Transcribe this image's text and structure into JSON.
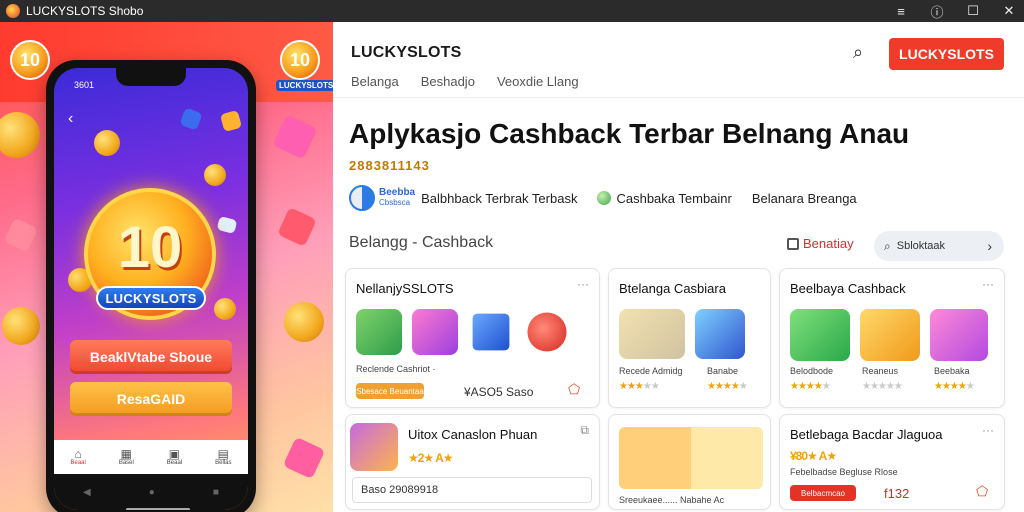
{
  "window": {
    "title": "LUCKYSLOTS Shobo"
  },
  "promo": {
    "corner_badge_left": "10",
    "corner_badge_right": "10",
    "corner_label": "LUCKYSLOTS",
    "phone": {
      "time": "3601",
      "badge_number": "10",
      "logo_text": "LUCKYSLOTS",
      "button_primary": "BeaklVtabe Sboue",
      "button_secondary": "ResaGAID",
      "nav": [
        "Beaal",
        "Basel",
        "Beaal",
        "Bellas"
      ]
    }
  },
  "header": {
    "brand": "LUCKYSLOTS",
    "nav": [
      "Belanga",
      "Beshadjo",
      "Veoxdie Llang"
    ],
    "cta": "LUCKYSLOTS"
  },
  "hero": {
    "headline": "Aplykasjo Cashback Terbar Belnang Anau",
    "tagline": "2883811143"
  },
  "features": {
    "logo_top": "Beebba",
    "logo_bottom": "Cbsbsca",
    "items": [
      "Balbhback Terbrak Terbask",
      "Cashbaka Tembainr",
      "Belanara Breanga"
    ]
  },
  "section": {
    "title": "Belangg - Cashback",
    "link": "Benatiay",
    "search": "Sbloktaak"
  },
  "cards": [
    {
      "title": "NellanjySSLOTS",
      "meta": "Reclende Cashriot ·",
      "badge": "Sbesace Beuantaa",
      "price": "¥ASO5 Saso"
    },
    {
      "title": "Btelanga Casbiara",
      "labels": [
        "Recede Admidg",
        "Banabe"
      ]
    },
    {
      "title": "Beelbaya Cashback",
      "labels": [
        "Belodbode",
        "Reaneus",
        "Beebaka"
      ]
    },
    {
      "title": "Uitox Canaslon Phuan",
      "rating": "★2★ A★",
      "field": "Baso 29089918"
    },
    {
      "title": "",
      "caption": "Sreeukaee...... Nabahe Ac"
    },
    {
      "title": "Betlebaga Bacdar Jlaguoa",
      "rating": "¥80★ A★",
      "meta": "Febelbadse Begluse Rlose",
      "badge": "Belbacmcao",
      "price": "f132"
    }
  ],
  "colors": {
    "accent": "#ef3b2a",
    "brand_blue": "#2a7be4",
    "star": "#f0a400"
  }
}
